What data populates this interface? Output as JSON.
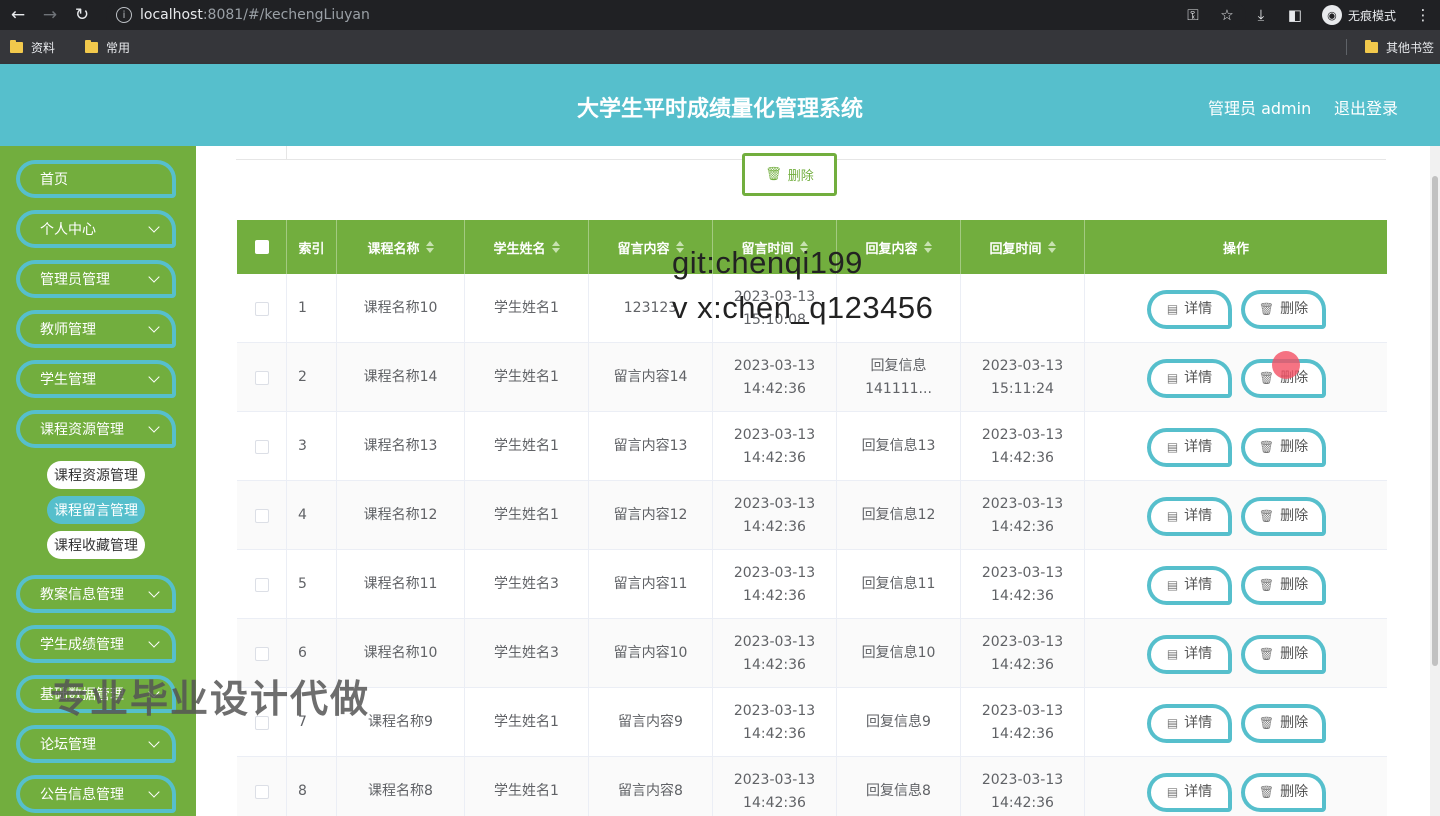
{
  "browser": {
    "url_host": "localhost",
    "url_rest": ":8081/#/kechengLiuyan",
    "incognito_label": "无痕模式",
    "bookmarks": [
      "资料",
      "常用"
    ],
    "other_bookmarks": "其他书签"
  },
  "header": {
    "title": "大学生平时成绩量化管理系统",
    "user": "管理员 admin",
    "logout": "退出登录"
  },
  "sidebar": {
    "items": [
      {
        "label": "首页",
        "has_chevron": false
      },
      {
        "label": "个人中心",
        "has_chevron": true
      },
      {
        "label": "管理员管理",
        "has_chevron": true
      },
      {
        "label": "教师管理",
        "has_chevron": true
      },
      {
        "label": "学生管理",
        "has_chevron": true
      },
      {
        "label": "课程资源管理",
        "has_chevron": true
      },
      {
        "label": "教案信息管理",
        "has_chevron": true
      },
      {
        "label": "学生成绩管理",
        "has_chevron": true
      },
      {
        "label": "基础数据管理",
        "has_chevron": true
      },
      {
        "label": "论坛管理",
        "has_chevron": true
      },
      {
        "label": "公告信息管理",
        "has_chevron": true
      }
    ],
    "subitems": [
      {
        "label": "课程资源管理",
        "active": false
      },
      {
        "label": "课程留言管理",
        "active": true
      },
      {
        "label": "课程收藏管理",
        "active": false
      }
    ]
  },
  "toolbar": {
    "delete_label": "删除"
  },
  "table": {
    "columns": [
      "索引",
      "课程名称",
      "学生姓名",
      "留言内容",
      "留言时间",
      "回复内容",
      "回复时间",
      "操作"
    ],
    "detail_label": "详情",
    "delete_label": "删除",
    "rows": [
      {
        "index": "1",
        "course": "课程名称10",
        "student": "学生姓名1",
        "message": "123123",
        "msg_time": "2023-03-13 15:10:08",
        "reply": "",
        "reply_time": ""
      },
      {
        "index": "2",
        "course": "课程名称14",
        "student": "学生姓名1",
        "message": "留言内容14",
        "msg_time": "2023-03-13 14:42:36",
        "reply": "回复信息141111...",
        "reply_time": "2023-03-13 15:11:24"
      },
      {
        "index": "3",
        "course": "课程名称13",
        "student": "学生姓名1",
        "message": "留言内容13",
        "msg_time": "2023-03-13 14:42:36",
        "reply": "回复信息13",
        "reply_time": "2023-03-13 14:42:36"
      },
      {
        "index": "4",
        "course": "课程名称12",
        "student": "学生姓名1",
        "message": "留言内容12",
        "msg_time": "2023-03-13 14:42:36",
        "reply": "回复信息12",
        "reply_time": "2023-03-13 14:42:36"
      },
      {
        "index": "5",
        "course": "课程名称11",
        "student": "学生姓名3",
        "message": "留言内容11",
        "msg_time": "2023-03-13 14:42:36",
        "reply": "回复信息11",
        "reply_time": "2023-03-13 14:42:36"
      },
      {
        "index": "6",
        "course": "课程名称10",
        "student": "学生姓名3",
        "message": "留言内容10",
        "msg_time": "2023-03-13 14:42:36",
        "reply": "回复信息10",
        "reply_time": "2023-03-13 14:42:36"
      },
      {
        "index": "7",
        "course": "课程名称9",
        "student": "学生姓名1",
        "message": "留言内容9",
        "msg_time": "2023-03-13 14:42:36",
        "reply": "回复信息9",
        "reply_time": "2023-03-13 14:42:36"
      },
      {
        "index": "8",
        "course": "课程名称8",
        "student": "学生姓名1",
        "message": "留言内容8",
        "msg_time": "2023-03-13 14:42:36",
        "reply": "回复信息8",
        "reply_time": "2023-03-13 14:42:36"
      }
    ]
  },
  "watermarks": {
    "git": "git:chenqi199",
    "vx": "v x:chen_q123456",
    "promo": "专业毕业设计代做"
  },
  "colors": {
    "header": "#56bfcc",
    "sidebar": "#72ae3e",
    "table_header": "#72ae3e",
    "button_border": "#56bfcc"
  }
}
